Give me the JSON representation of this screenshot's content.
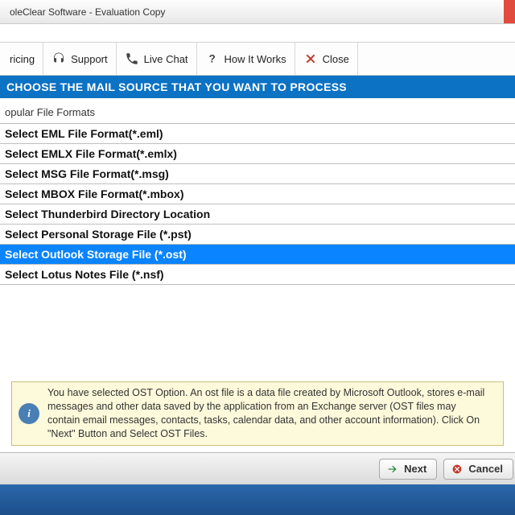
{
  "titlebar": {
    "title": "oleClear Software - Evaluation Copy"
  },
  "toolbar": {
    "items": [
      {
        "label": "ricing"
      },
      {
        "label": "Support"
      },
      {
        "label": "Live Chat"
      },
      {
        "label": "How It Works"
      },
      {
        "label": "Close"
      }
    ]
  },
  "banner": {
    "text": "CHOOSE THE MAIL SOURCE THAT YOU WANT TO PROCESS"
  },
  "section": {
    "label": "opular File Formats"
  },
  "formats": [
    {
      "label": "Select EML File Format(*.eml)",
      "selected": false
    },
    {
      "label": "Select EMLX File Format(*.emlx)",
      "selected": false
    },
    {
      "label": "Select MSG File Format(*.msg)",
      "selected": false
    },
    {
      "label": "Select MBOX File Format(*.mbox)",
      "selected": false
    },
    {
      "label": "Select Thunderbird Directory Location",
      "selected": false
    },
    {
      "label": "Select Personal Storage File (*.pst)",
      "selected": false
    },
    {
      "label": "Select Outlook Storage File (*.ost)",
      "selected": true
    },
    {
      "label": "Select Lotus Notes File (*.nsf)",
      "selected": false
    }
  ],
  "info": {
    "text": "You have selected OST Option. An ost file is a data file created by Microsoft Outlook, stores e-mail messages and other data saved by the application from an Exchange server (OST files may contain email messages, contacts, tasks, calendar data, and other account information). Click On \"Next\" Button and Select OST Files."
  },
  "footer": {
    "next": "Next",
    "cancel": "Cancel"
  }
}
